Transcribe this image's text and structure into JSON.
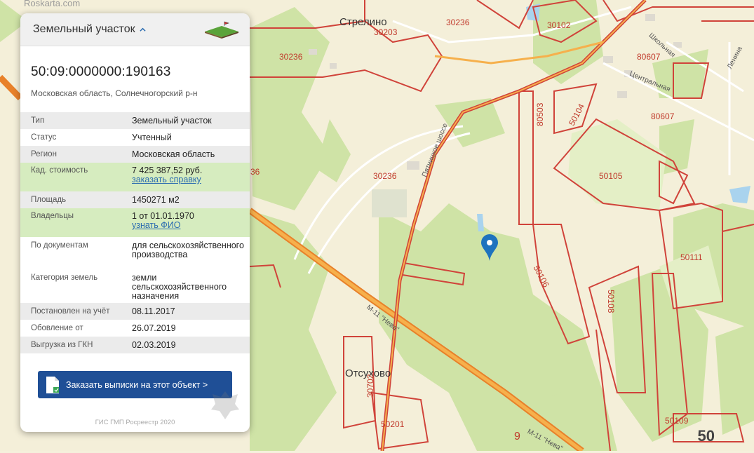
{
  "watermark": "Roskarta.com",
  "panel": {
    "title": "Земельный участок",
    "cadastral_number": "50:09:0000000:190163",
    "address": "Московская область, Солнечногорский р-н",
    "rows": [
      {
        "key": "Тип",
        "value": "Земельный участок"
      },
      {
        "key": "Статус",
        "value": "Учтенный"
      },
      {
        "key": "Регион",
        "value": "Московская область"
      },
      {
        "key": "Кад. стоимость",
        "value": "7 425 387,52 руб.",
        "link": "заказать справку"
      },
      {
        "key": "Площадь",
        "value": "1450271 м2"
      },
      {
        "key": "Владельцы",
        "value": "1 от 01.01.1970",
        "link": "узнать ФИО"
      },
      {
        "key": "По документам",
        "value": "для сельскохозяйственного производства"
      },
      {
        "key": "Категория земель",
        "value": "земли сельскохозяйственного назначения"
      },
      {
        "key": "Постановлен на учёт",
        "value": "08.11.2017"
      },
      {
        "key": "Обовление от",
        "value": "26.07.2019"
      },
      {
        "key": "Выгрузка из ГКН",
        "value": "02.03.2019"
      }
    ],
    "order_button": "Заказать выписки на этот объект >",
    "footer": "ГИС ГМП Росреестр 2020"
  },
  "map": {
    "places": [
      "Стрелино",
      "Отсухово"
    ],
    "roads": [
      "Пятницкое шоссе",
      "М-11 \"Нева\"",
      "М-11 \"Нева\"",
      "Школьная",
      "Центральная",
      "Ленина"
    ],
    "zone_labels": [
      "30203",
      "30236",
      "30236",
      "30102",
      "80607",
      "80607",
      "80503",
      "50104",
      "30236",
      "50105",
      "36",
      "50106",
      "50108",
      "50111",
      "30702",
      "50201",
      "50109",
      "9"
    ],
    "corner_number": "50",
    "colors": {
      "boundary": "#d0433a",
      "forest": "#cfe3a6",
      "field": "#f3eed6",
      "highway": "#f0962a"
    }
  }
}
